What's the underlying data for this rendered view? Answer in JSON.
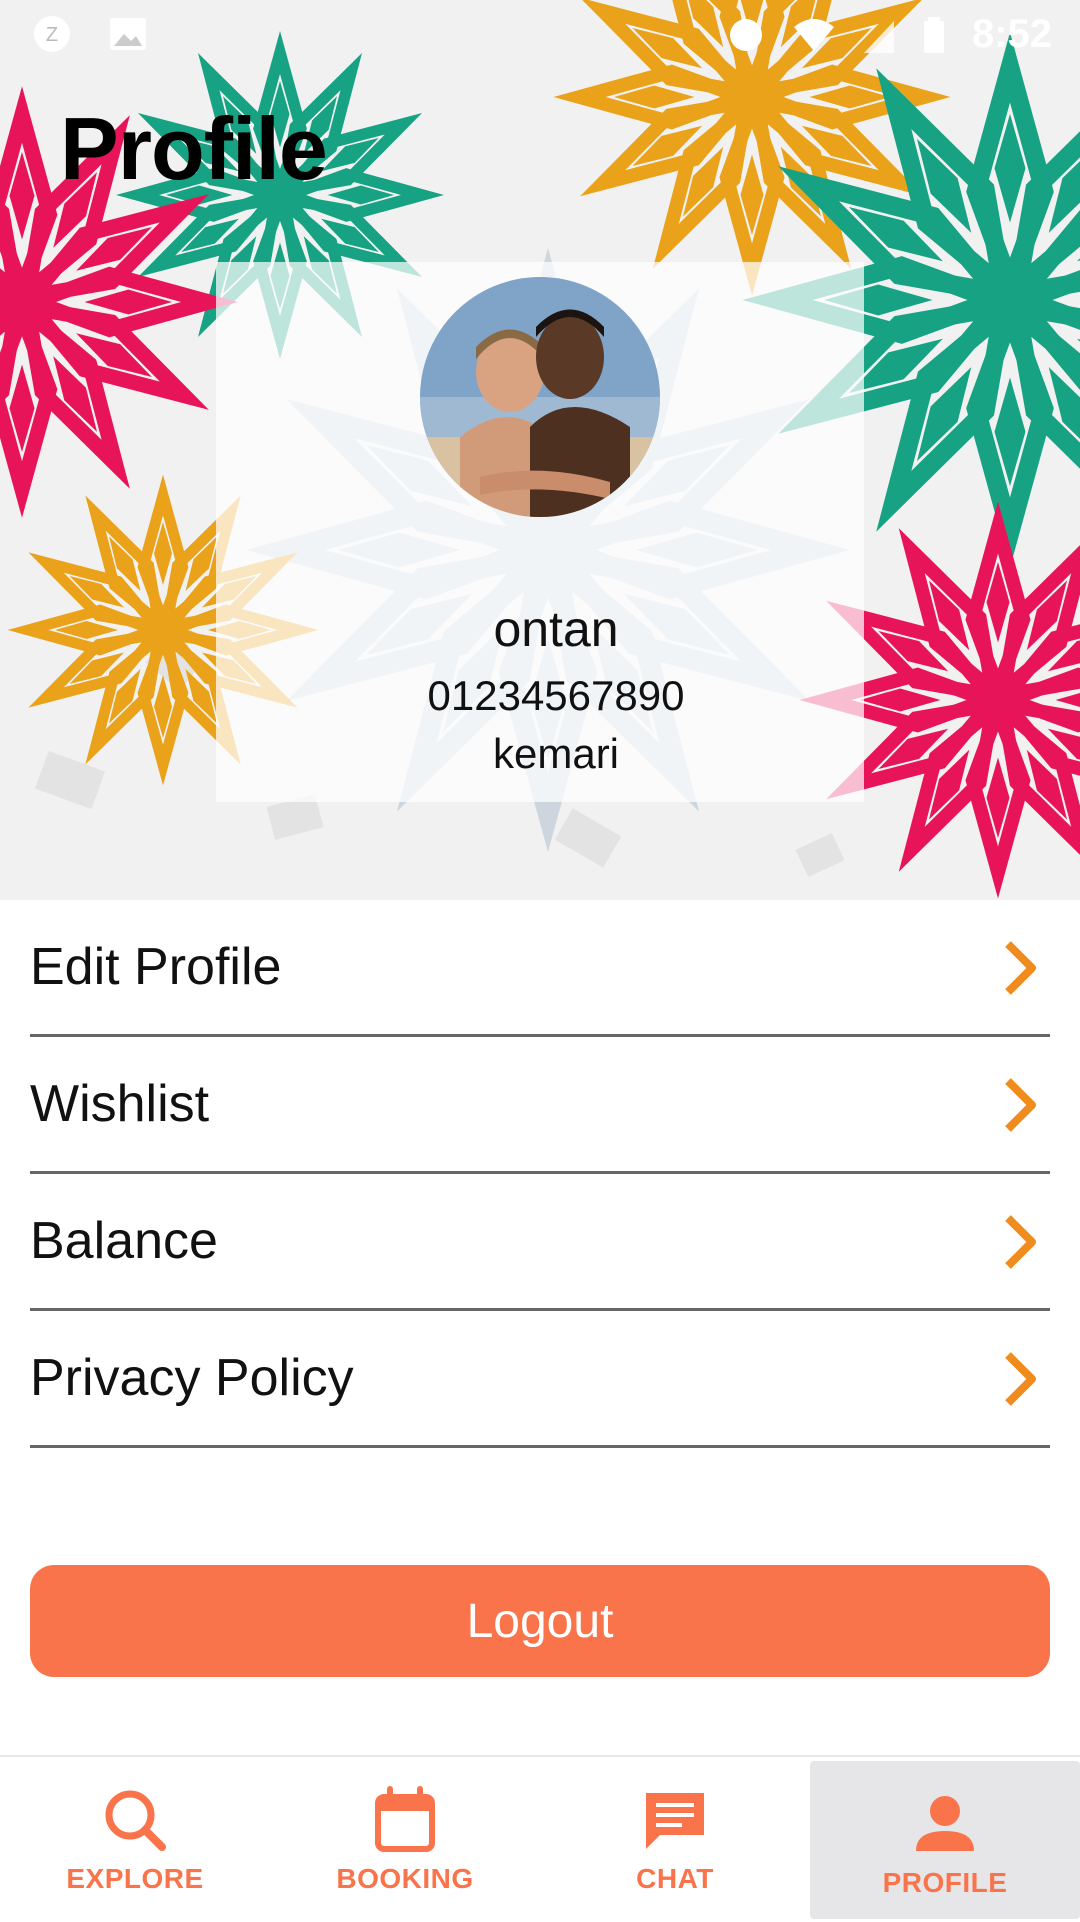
{
  "status_bar": {
    "time": "8:52"
  },
  "page": {
    "title": "Profile"
  },
  "profile": {
    "name": "ontan",
    "phone": "01234567890",
    "username": "kemari"
  },
  "menu": {
    "items": [
      {
        "label": "Edit Profile"
      },
      {
        "label": "Wishlist"
      },
      {
        "label": "Balance"
      },
      {
        "label": "Privacy Policy"
      }
    ]
  },
  "logout": {
    "label": "Logout"
  },
  "bottom_nav": {
    "items": [
      {
        "label": "EXPLORE",
        "icon": "search-icon"
      },
      {
        "label": "BOOKING",
        "icon": "calendar-icon"
      },
      {
        "label": "CHAT",
        "icon": "chat-icon"
      },
      {
        "label": "PROFILE",
        "icon": "person-icon"
      }
    ],
    "active": "PROFILE"
  },
  "colors": {
    "accent": "#f9744a",
    "mandala_pink": "#e8145a",
    "mandala_teal": "#17a383",
    "mandala_gold": "#e9a21a",
    "mandala_grey": "#c8d3dc"
  }
}
